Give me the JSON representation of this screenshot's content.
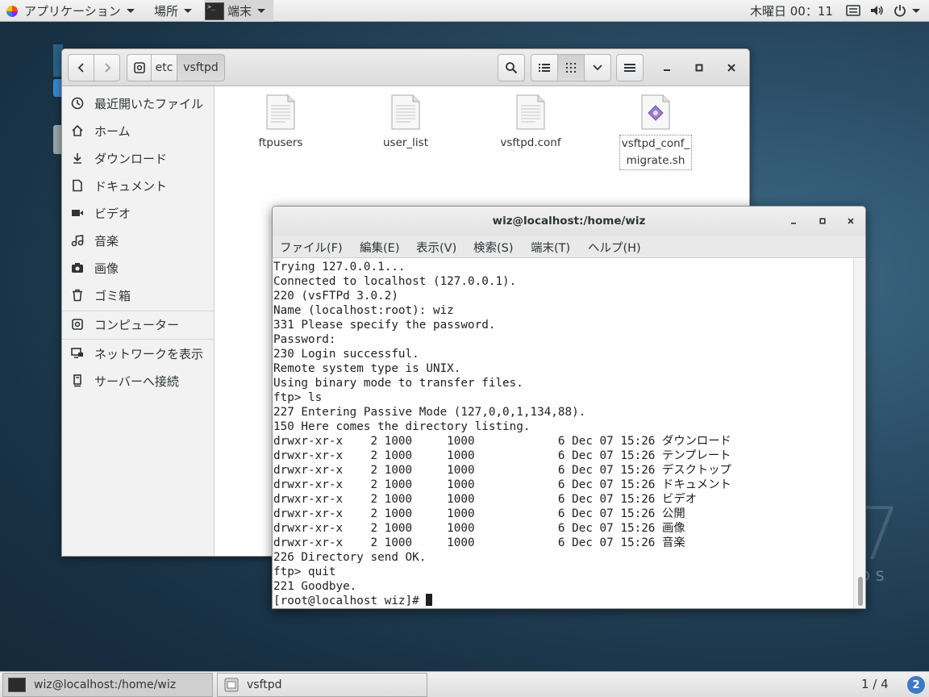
{
  "topbar": {
    "applications": "アプリケーション",
    "places": "場所",
    "terminal": "端末",
    "terminal_icon_text": ">_",
    "datetime": "木曜日 00：11"
  },
  "file_manager": {
    "path": [
      "etc",
      "vsftpd"
    ],
    "sidebar": [
      {
        "label": "最近開いたファイル",
        "icon": "clock-icon"
      },
      {
        "label": "ホーム",
        "icon": "home-icon"
      },
      {
        "label": "ダウンロード",
        "icon": "download-icon"
      },
      {
        "label": "ドキュメント",
        "icon": "document-icon"
      },
      {
        "label": "ビデオ",
        "icon": "video-icon"
      },
      {
        "label": "音楽",
        "icon": "music-icon"
      },
      {
        "label": "画像",
        "icon": "camera-icon"
      },
      {
        "label": "ゴミ箱",
        "icon": "trash-icon"
      },
      {
        "label": "コンピューター",
        "icon": "computer-icon"
      },
      {
        "label": "ネットワークを表示",
        "icon": "network-icon"
      },
      {
        "label": "サーバーへ接続",
        "icon": "server-icon"
      }
    ],
    "files": [
      {
        "name": "ftpusers",
        "type": "text"
      },
      {
        "name": "user_list",
        "type": "text"
      },
      {
        "name": "vsftpd.conf",
        "type": "text"
      },
      {
        "name": "vsftpd_conf_\nmigrate.sh",
        "type": "script"
      }
    ]
  },
  "terminal": {
    "title": "wiz@localhost:/home/wiz",
    "menu": [
      "ファイル(F)",
      "編集(E)",
      "表示(V)",
      "検索(S)",
      "端末(T)",
      "ヘルプ(H)"
    ],
    "lines": [
      "Trying 127.0.0.1...",
      "Connected to localhost (127.0.0.1).",
      "220 (vsFTPd 3.0.2)",
      "Name (localhost:root): wiz",
      "331 Please specify the password.",
      "Password:",
      "230 Login successful.",
      "Remote system type is UNIX.",
      "Using binary mode to transfer files.",
      "ftp> ls",
      "227 Entering Passive Mode (127,0,0,1,134,88).",
      "150 Here comes the directory listing.",
      "drwxr-xr-x    2 1000     1000            6 Dec 07 15:26 ダウンロード",
      "drwxr-xr-x    2 1000     1000            6 Dec 07 15:26 テンプレート",
      "drwxr-xr-x    2 1000     1000            6 Dec 07 15:26 デスクトップ",
      "drwxr-xr-x    2 1000     1000            6 Dec 07 15:26 ドキュメント",
      "drwxr-xr-x    2 1000     1000            6 Dec 07 15:26 ビデオ",
      "drwxr-xr-x    2 1000     1000            6 Dec 07 15:26 公開",
      "drwxr-xr-x    2 1000     1000            6 Dec 07 15:26 画像",
      "drwxr-xr-x    2 1000     1000            6 Dec 07 15:26 音楽",
      "226 Directory send OK.",
      "ftp> quit",
      "221 Goodbye."
    ],
    "prompt": "[root@localhost wiz]# "
  },
  "taskbar": {
    "tasks": [
      "wiz@localhost:/home/wiz",
      "vsftpd"
    ],
    "workspace": "1 / 4",
    "help": "2"
  },
  "desktop": {
    "brand_number": "7",
    "brand_text": "TOS"
  }
}
